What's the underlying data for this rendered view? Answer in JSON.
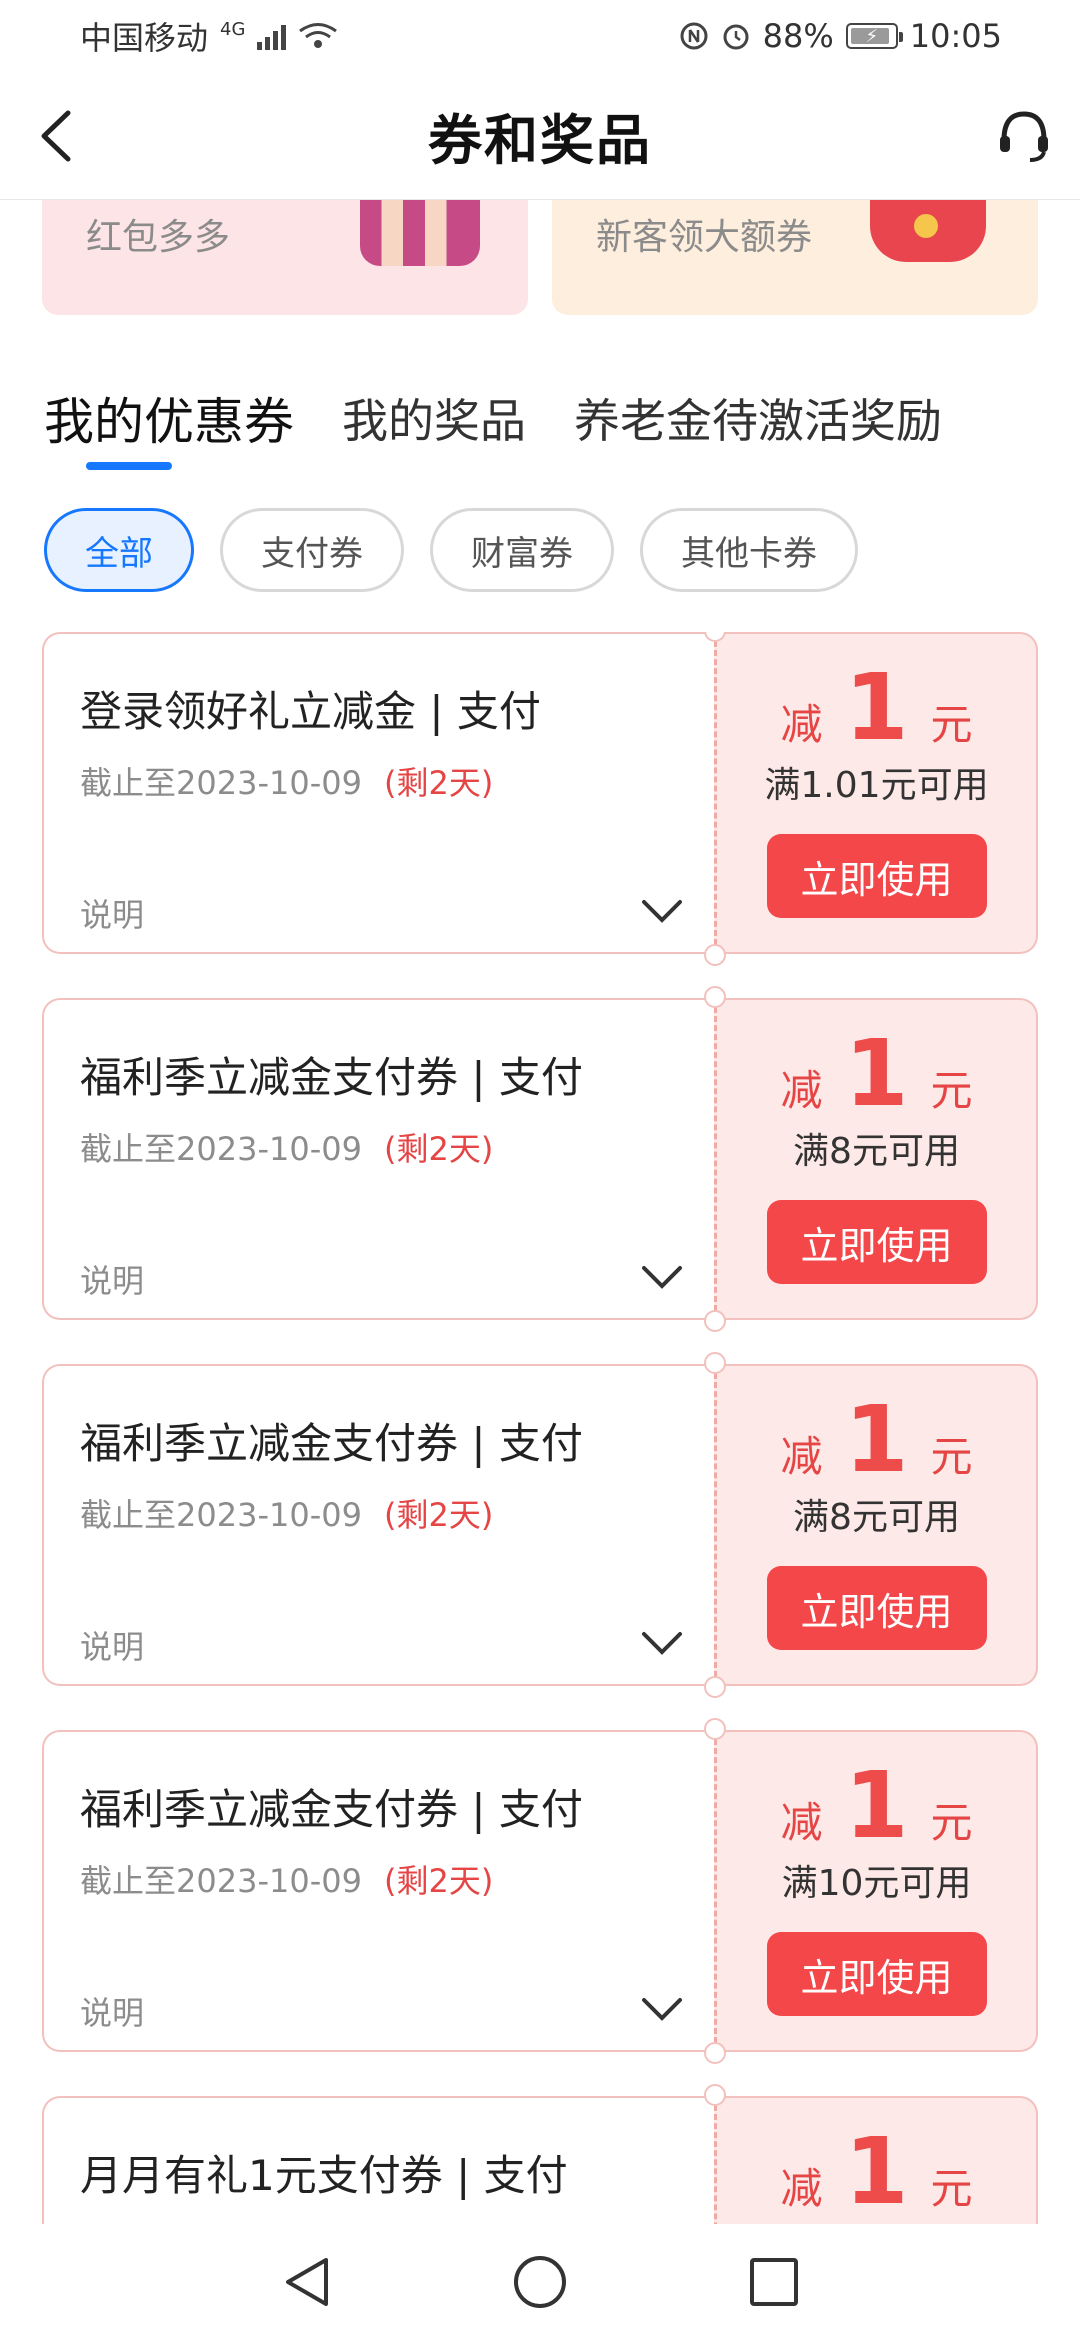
{
  "status_bar": {
    "carrier": "中国移动",
    "network": "4G",
    "battery_percent": "88%",
    "time": "10:05"
  },
  "header": {
    "title": "券和奖品",
    "back_icon": "chevron-left-icon",
    "service_icon": "headset-icon"
  },
  "promos": [
    {
      "text": "红包多多",
      "color": "#fde4e6"
    },
    {
      "text": "新客领大额券",
      "color": "#fdeedd"
    }
  ],
  "tabs": [
    {
      "label": "我的优惠券",
      "active": true
    },
    {
      "label": "我的奖品",
      "active": false
    },
    {
      "label": "养老金待激活奖励",
      "active": false
    }
  ],
  "filters": [
    {
      "label": "全部",
      "active": true
    },
    {
      "label": "支付券",
      "active": false
    },
    {
      "label": "财富券",
      "active": false
    },
    {
      "label": "其他卡券",
      "active": false
    }
  ],
  "coupons": [
    {
      "title": "登录领好礼立减金 | 支付",
      "expiry": "截止至2023-10-09",
      "remaining": "(剩2天)",
      "note": "说明",
      "prefix": "减",
      "amount": "1",
      "unit": "元",
      "threshold": "满1.01元可用",
      "button": "立即使用"
    },
    {
      "title": "福利季立减金支付券 | 支付",
      "expiry": "截止至2023-10-09",
      "remaining": "(剩2天)",
      "note": "说明",
      "prefix": "减",
      "amount": "1",
      "unit": "元",
      "threshold": "满8元可用",
      "button": "立即使用"
    },
    {
      "title": "福利季立减金支付券 | 支付",
      "expiry": "截止至2023-10-09",
      "remaining": "(剩2天)",
      "note": "说明",
      "prefix": "减",
      "amount": "1",
      "unit": "元",
      "threshold": "满8元可用",
      "button": "立即使用"
    },
    {
      "title": "福利季立减金支付券 | 支付",
      "expiry": "截止至2023-10-09",
      "remaining": "(剩2天)",
      "note": "说明",
      "prefix": "减",
      "amount": "1",
      "unit": "元",
      "threshold": "满10元可用",
      "button": "立即使用"
    },
    {
      "title": "月月有礼1元支付券 | 支付",
      "expiry": "",
      "remaining": "",
      "note": "",
      "prefix": "减",
      "amount": "1",
      "unit": "元",
      "threshold": "",
      "button": ""
    }
  ],
  "colors": {
    "accent_blue": "#1677ff",
    "coupon_red": "#ee4b4b",
    "button_red": "#f4474a",
    "coupon_bg": "#fde9e7"
  },
  "nav_bar": {
    "back": "triangle-back-icon",
    "home": "circle-home-icon",
    "recents": "square-recents-icon"
  }
}
